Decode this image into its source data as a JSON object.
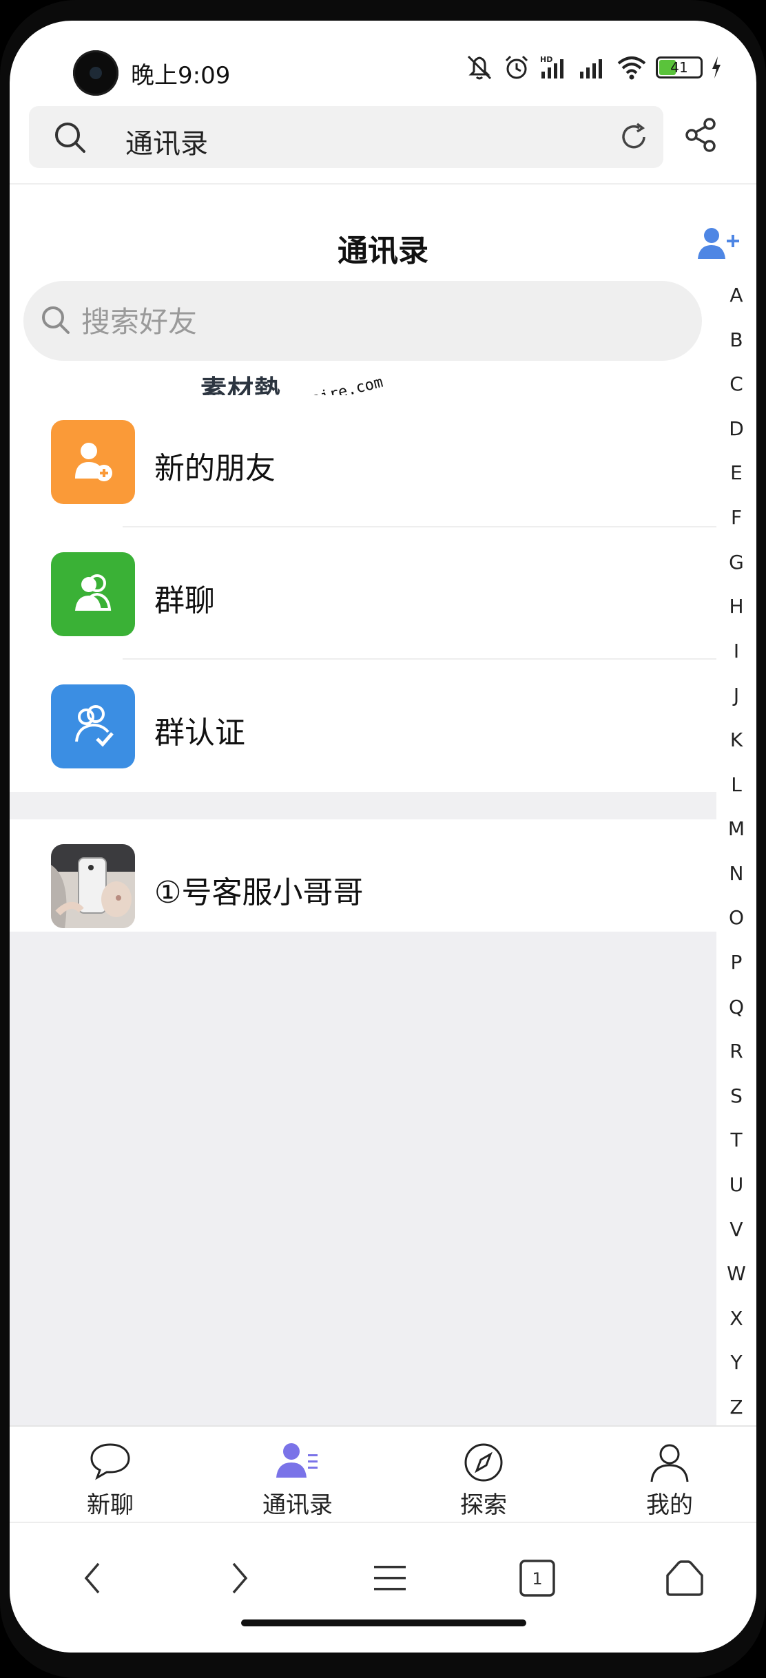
{
  "status_bar": {
    "time": "晚上9:09",
    "battery": "41",
    "network": "HD"
  },
  "browser": {
    "url_text": "通讯录"
  },
  "header": {
    "title": "通讯录"
  },
  "search": {
    "placeholder": "搜索好友"
  },
  "watermark": {
    "cn": "素材熱",
    "en": "sucaire.com"
  },
  "list": {
    "new_friends": "新的朋友",
    "group_chat": "群聊",
    "group_verify": "群认证",
    "contact_name": "①号客服小哥哥"
  },
  "index_letters": [
    "A",
    "B",
    "C",
    "D",
    "E",
    "F",
    "G",
    "H",
    "I",
    "J",
    "K",
    "L",
    "M",
    "N",
    "O",
    "P",
    "Q",
    "R",
    "S",
    "T",
    "U",
    "V",
    "W",
    "X",
    "Y",
    "Z"
  ],
  "tabs": [
    "新聊",
    "通讯录",
    "探索",
    "我的"
  ],
  "active_tab": "通讯录",
  "nav": {
    "tab_count": "1"
  },
  "colors": {
    "orange": "#fa9a38",
    "green": "#3ab136",
    "blue": "#3b8ee3",
    "accent": "#4e86e4",
    "active_tab_purple": "#7a73e8"
  }
}
